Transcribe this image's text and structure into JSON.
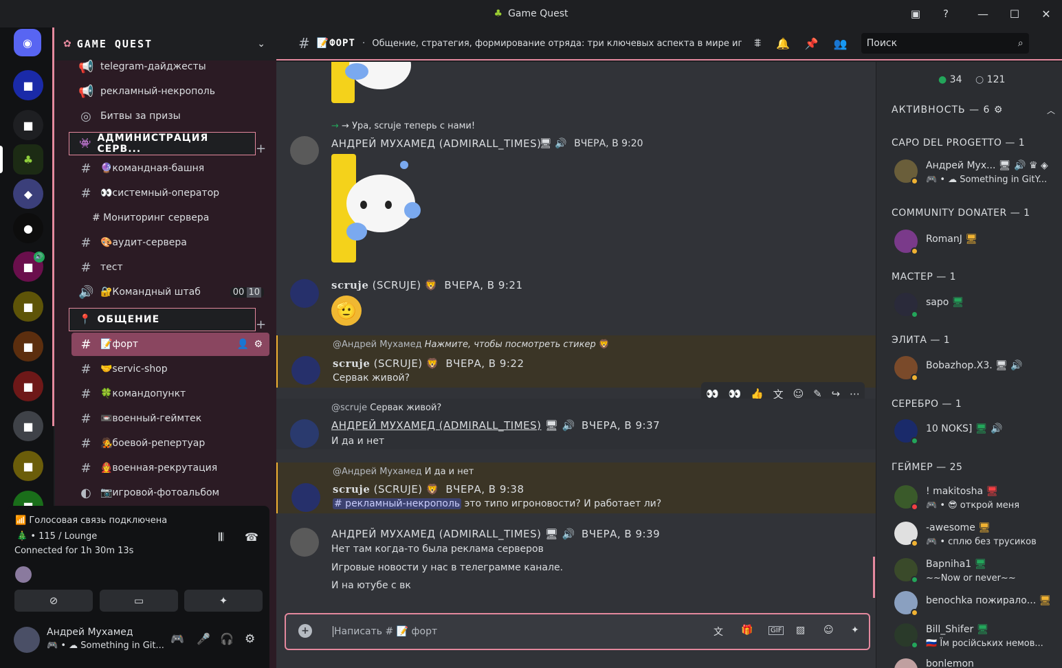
{
  "window": {
    "title": "Game Quest"
  },
  "server": {
    "name": "GAME QUEST"
  },
  "channels_top": [
    "telegram-дайджесты",
    "рекламный-некрополь",
    "Битвы за призы"
  ],
  "cat_admin": "АДМИНИСТРАЦИЯ СЕРВ...",
  "admin_channels": [
    "🔮командная-башня",
    "👀системный-оператор",
    "# Мониторинг сервера",
    "🎨аудит-сервера",
    "тест",
    "🔐Командный штаб"
  ],
  "admin_voice_counts": [
    "00",
    "10"
  ],
  "cat_social": "ОБЩЕНИЕ",
  "social_channels": [
    "📝форт",
    "🤝servic-shop",
    "🍀командопункт",
    "📼военный-геймтек",
    "🧑‍🎤боевой-репертуар",
    "🧑‍🚒военная-рекрутация",
    "📷игровой-фотоальбом"
  ],
  "voice": {
    "status": "Голосовая связь подключена",
    "channel": "115 / Lounge",
    "connected": "Connected for 1h 30m 13s"
  },
  "user": {
    "name": "Андрей Мухамед",
    "status": "Something in Git..."
  },
  "topbar": {
    "channel": "📝ФОРТ",
    "topic": "Общение, стратегия, формирование отряда: три ключевых аспекта в мире игр. ...",
    "search_placeholder": "Поиск"
  },
  "messages": {
    "join": "→ Ура, scruje теперь с нами!",
    "m1_name": "АНДРЕЙ МУХАМЕД (ADMIRALL_TIMES)",
    "m1_time": "ВЧЕРА, В 9:20",
    "m2_name": "scruje",
    "m2_tag": "(SCRUJE)",
    "m2_time": "ВЧЕРА, В 9:21",
    "m3_reply_user": "@Андрей Мухамед",
    "m3_reply_text": "Нажмите, чтобы посмотреть стикер",
    "m3_name": "scruje",
    "m3_tag": "(SCRUJE)",
    "m3_time": "ВЧЕРА, В 9:22",
    "m3_text": "Сервак живой?",
    "m4_reply_user": "@scruje",
    "m4_reply_text": "Сервак живой?",
    "m4_name": "АНДРЕЙ МУХАМЕД (ADMIRALL_TIMES)",
    "m4_time": "ВЧЕРА, В 9:37",
    "m4_text": "И да и нет",
    "m5_reply_user": "@Андрей Мухамед",
    "m5_reply_text": "И да и нет",
    "m5_name": "scruje",
    "m5_tag": "(SCRUJE)",
    "m5_time": "ВЧЕРА, В 9:38",
    "m5_mention": "# рекламный-некрополь",
    "m5_text": " это типо игроновости? И работает ли?",
    "m6_name": "АНДРЕЙ МУХАМЕД (ADMIRALL_TIMES)",
    "m6_time": "ВЧЕРА, В 9:39",
    "m6_l1": "Нет там когда-то была реклама серверов",
    "m6_l2": "Игровые новости у нас в телеграмме канале.",
    "m6_l3": "И на ютубе с вк"
  },
  "input": {
    "placeholder": "Написать # 📝 форт"
  },
  "members": {
    "online": "34",
    "offline": "121",
    "activity": "АКТИВНОСТЬ — 6",
    "roles": [
      {
        "name": "CAPO DEL PROGETTO — 1"
      },
      {
        "name": "COMMUNITY DONATER — 1"
      },
      {
        "name": "МАСТЕР — 1"
      },
      {
        "name": "ЭЛИТА — 1"
      },
      {
        "name": "СЕРЕБРО — 1"
      },
      {
        "name": "ГЕЙМЕР — 25"
      }
    ],
    "list": [
      {
        "name": "Андрей Мух...",
        "status": "🎮 • ☁ Something in GitY..."
      },
      {
        "name": "RomanJ",
        "status": ""
      },
      {
        "name": "sapo",
        "status": ""
      },
      {
        "name": "Bobazhop.X3.",
        "status": ""
      },
      {
        "name": "10 NOKS]",
        "status": ""
      },
      {
        "name": "! makitosha",
        "status": "🎮 • 😎 открой меня"
      },
      {
        "name": "-awesome",
        "status": "🎮 • сплю без трусиков"
      },
      {
        "name": "Bapniha1",
        "status": "~~Now or never~~"
      },
      {
        "name": "benochka пожирало...",
        "status": ""
      },
      {
        "name": "Bill_Shifer",
        "status": "🇷🇺 Їм російських немов..."
      },
      {
        "name": "bonlemon",
        "status": ""
      }
    ]
  }
}
